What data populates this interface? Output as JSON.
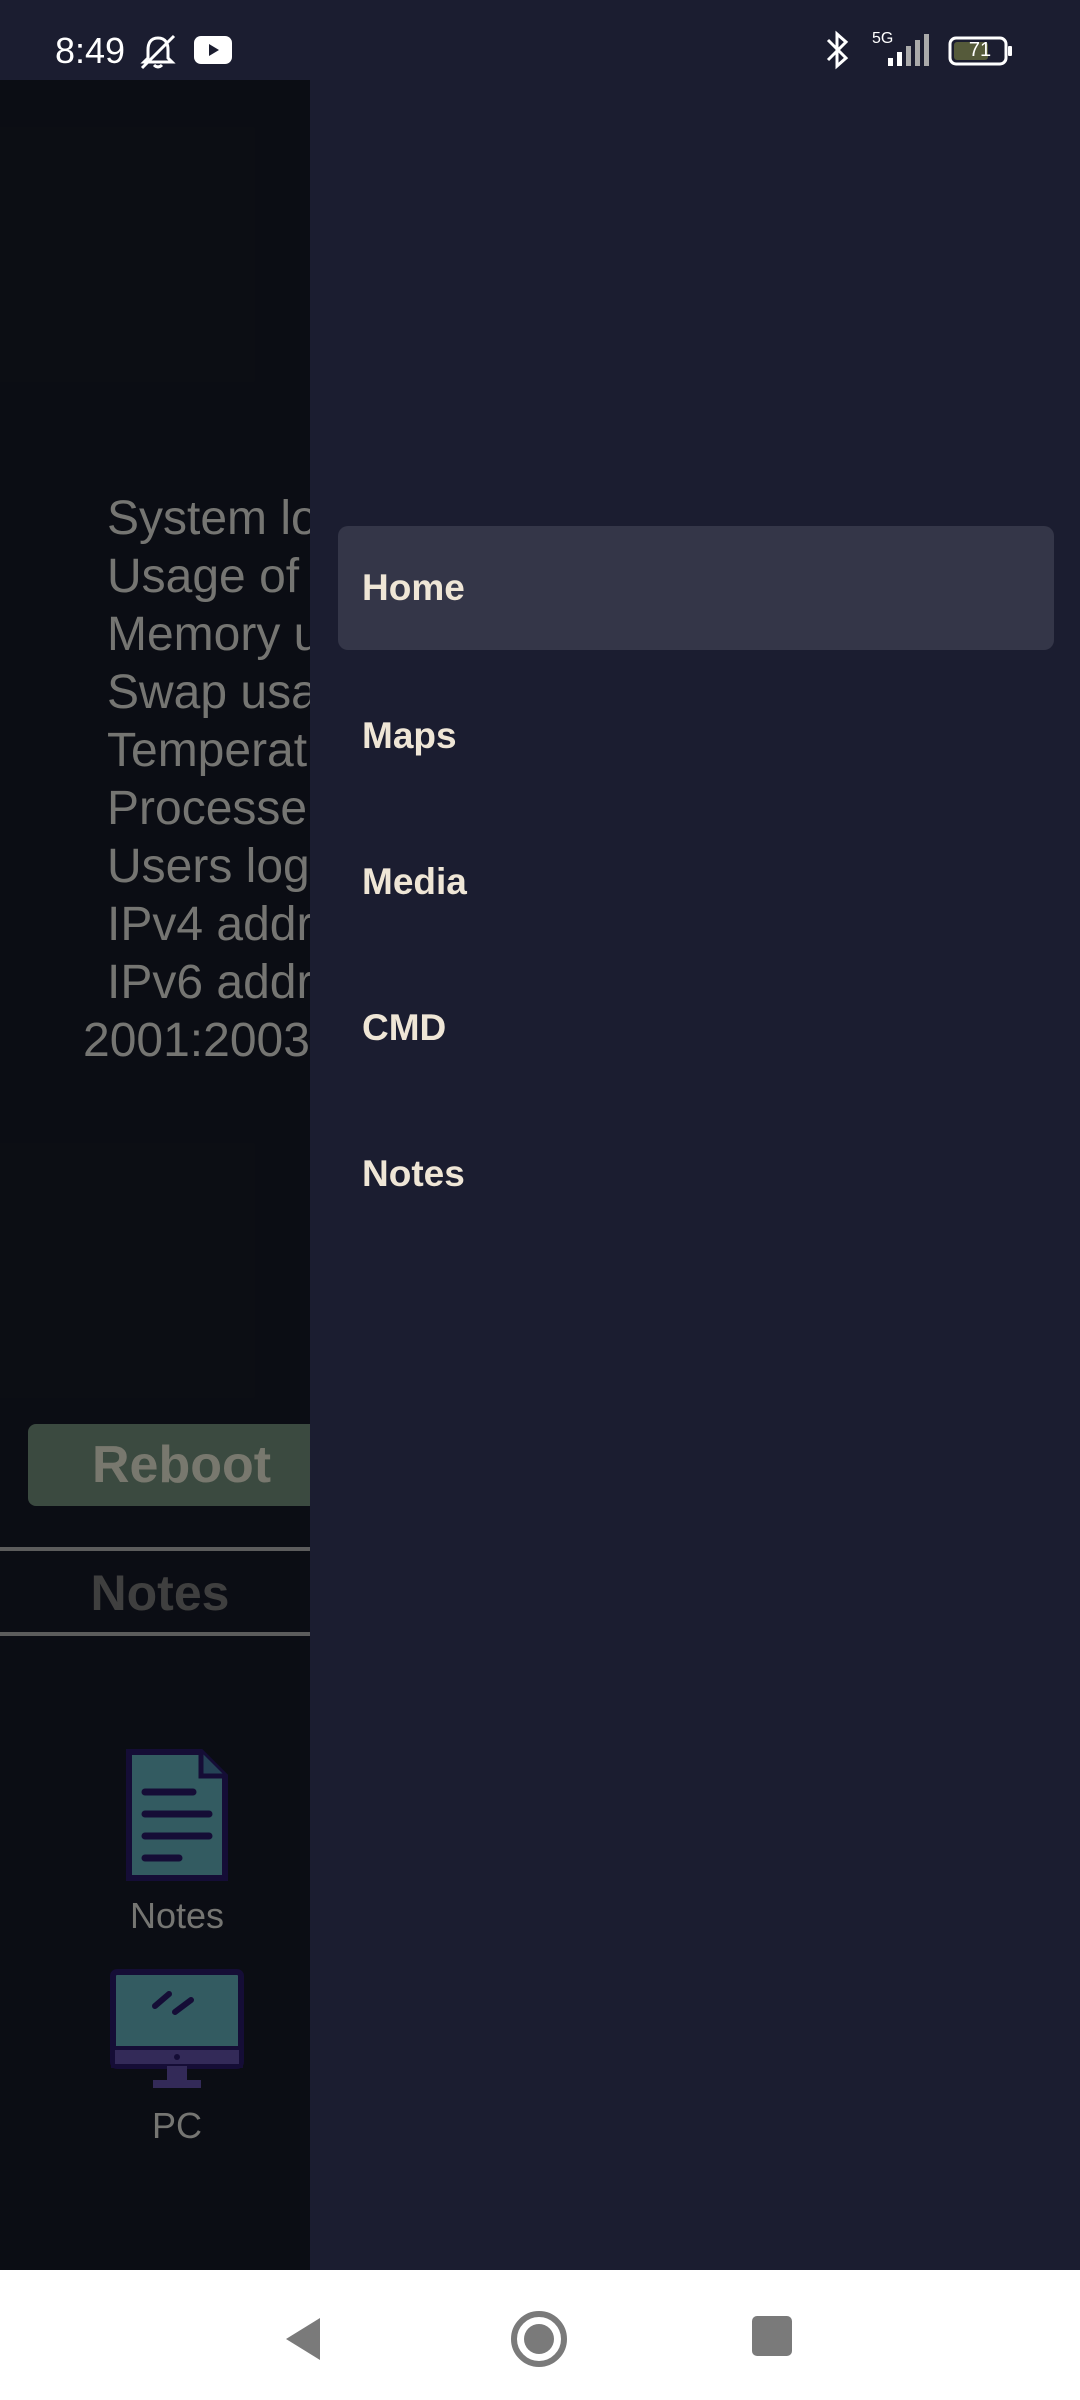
{
  "status_bar": {
    "time": "8:49",
    "network": "5G",
    "battery": "71",
    "icons": [
      "mute-icon",
      "youtube-icon",
      "bluetooth-icon",
      "signal-icon",
      "battery-icon"
    ]
  },
  "main": {
    "stats": [
      "System lo",
      "Usage of",
      "Memory u",
      "Swap usa",
      "Temperat",
      "Processe",
      "Users log",
      "IPv4 addr",
      "IPv6 addr",
      "2001:2003"
    ],
    "reboot_label": "Reboot",
    "notes_heading": "Notes",
    "apps": [
      {
        "label": "Notes",
        "icon": "document-icon"
      },
      {
        "label": "PC",
        "icon": "monitor-icon"
      }
    ]
  },
  "drawer": {
    "items": [
      {
        "label": "Home",
        "active": true
      },
      {
        "label": "Maps",
        "active": false
      },
      {
        "label": "Media",
        "active": false
      },
      {
        "label": "CMD",
        "active": false
      },
      {
        "label": "Notes",
        "active": false
      }
    ]
  },
  "colors": {
    "drawer_bg": "#1b1d30",
    "active_item_bg": "#343648",
    "menu_text": "#efe6d6",
    "reboot_bg": "#46574c"
  }
}
